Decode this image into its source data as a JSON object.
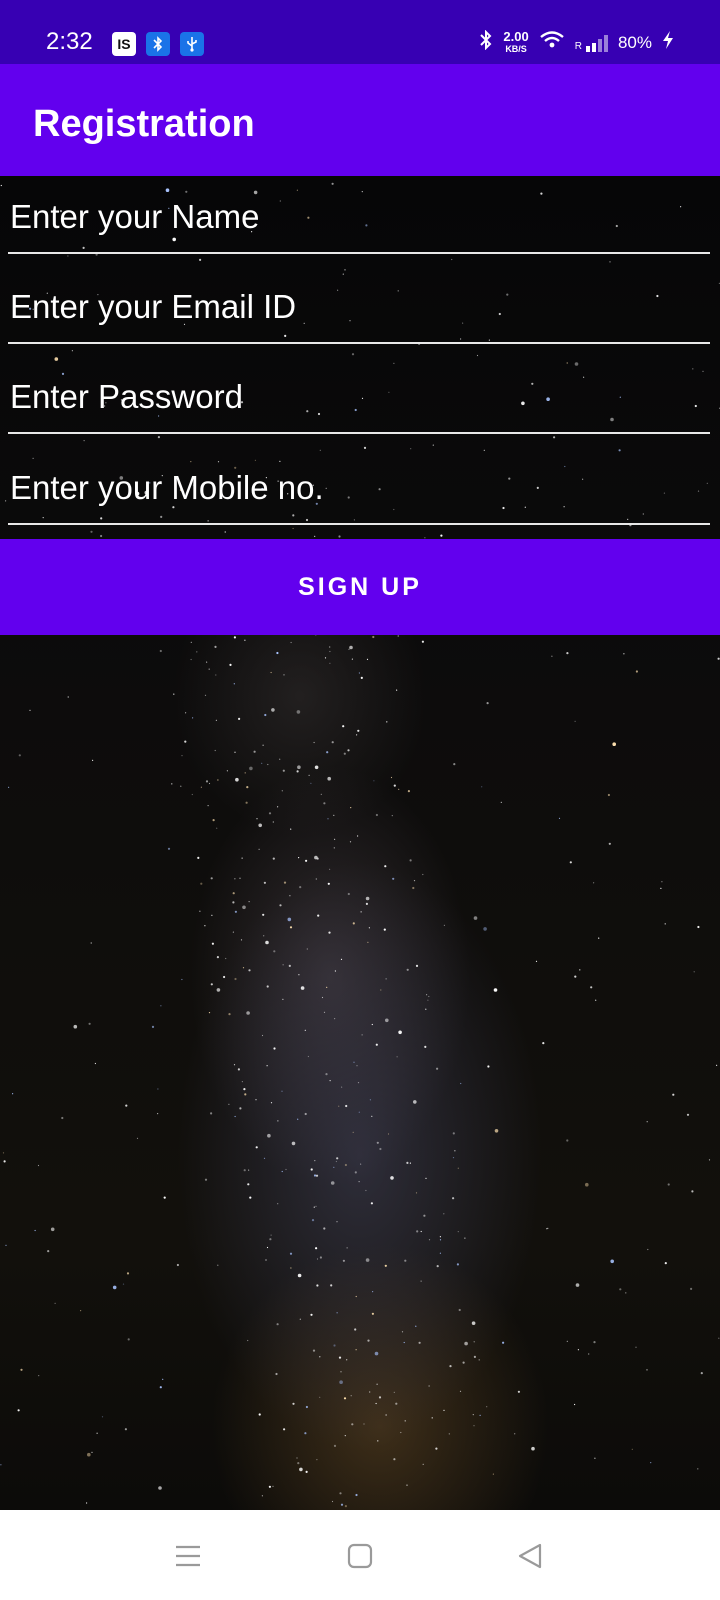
{
  "status_bar": {
    "time": "2:32",
    "app_icon_label": "IS",
    "network_speed_value": "2.00",
    "network_speed_unit": "KB/S",
    "roaming_label": "R",
    "battery": "80%"
  },
  "app_bar": {
    "title": "Registration"
  },
  "form": {
    "name_placeholder": "Enter your Name",
    "email_placeholder": "Enter your Email ID",
    "password_placeholder": "Enter Password",
    "mobile_placeholder": "Enter your Mobile no.",
    "signup_label": "SIGN UP"
  },
  "colors": {
    "status_bar": "#3700b3",
    "primary": "#6200ee",
    "nav_bar": "#ffffff"
  },
  "icons": {
    "status": [
      "bluetooth-icon",
      "usb-icon",
      "wifi-icon",
      "signal-icon",
      "charging-icon"
    ],
    "nav": [
      "menu-icon",
      "home-icon",
      "back-icon"
    ]
  }
}
